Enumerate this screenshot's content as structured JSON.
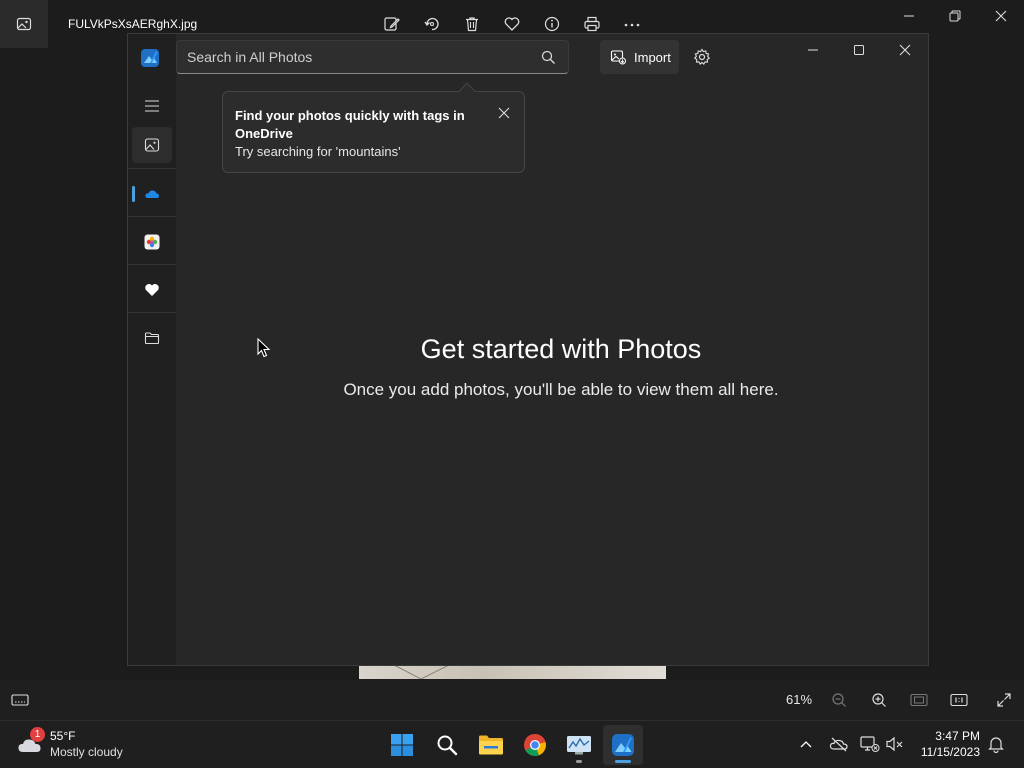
{
  "viewer": {
    "filename": "FULVkPsXsAERghX.jpg",
    "zoom_level": "61%"
  },
  "photos": {
    "search": {
      "placeholder": "Search in All Photos"
    },
    "import_label": "Import",
    "tip": {
      "title": "Find your photos quickly with tags in OneDrive",
      "body": "Try searching for 'mountains'"
    },
    "empty_state": {
      "title": "Get started with Photos",
      "subtitle": "Once you add photos, you'll be able to view them all here."
    },
    "nav_items": [
      "menu-icon",
      "all-photos-icon",
      "onedrive-icon",
      "icloud-photos-icon",
      "favorites-heart-icon",
      "folders-icon"
    ]
  },
  "taskbar": {
    "weather": {
      "badge": "1",
      "temp": "55°F",
      "condition": "Mostly cloudy"
    },
    "apps": [
      "start-icon",
      "search-icon",
      "file-explorer-icon",
      "chrome-icon",
      "system-monitor-icon",
      "photos-icon"
    ],
    "clock": {
      "time": "3:47 PM",
      "date": "11/15/2023"
    }
  },
  "colors": {
    "accent": "#4ca0e0",
    "window_bg": "#272727",
    "rail_bg": "#202020",
    "taskbar_bg": "#1f1f1f"
  }
}
